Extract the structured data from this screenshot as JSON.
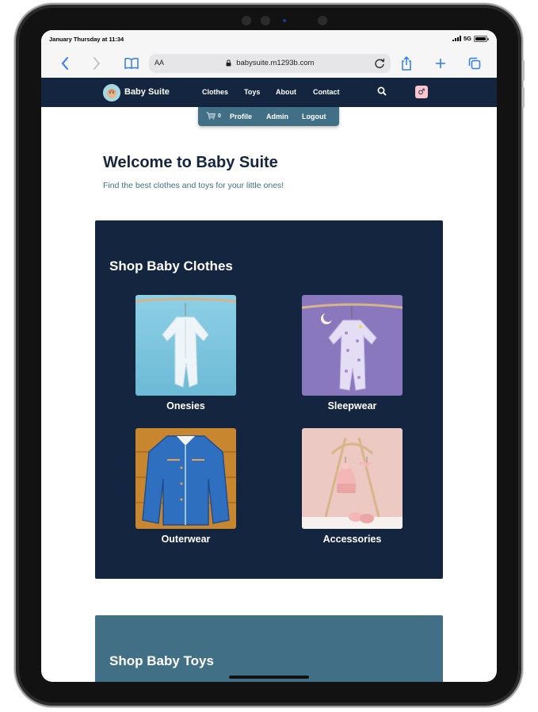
{
  "status_bar": {
    "time": "January Thursday at 11:34",
    "network": "5G"
  },
  "browser": {
    "text_size_label": "AA",
    "url": "babysuite.m1293b.com",
    "icons": [
      "back-icon",
      "forward-icon",
      "bookmarks-icon",
      "lock-icon",
      "reload-icon",
      "share-icon",
      "new-tab-icon",
      "tabs-icon"
    ]
  },
  "nav": {
    "brand": "Baby Suite",
    "links": [
      "Clothes",
      "Toys",
      "About",
      "Contact"
    ],
    "search_icon": "search-icon",
    "gender_symbol": "♂"
  },
  "user_menu": {
    "cart_count": "0",
    "profile": "Profile",
    "admin": "Admin",
    "logout": "Logout"
  },
  "hero": {
    "title": "Welcome to Baby Suite",
    "subtitle": "Find the best clothes and toys for your little ones!"
  },
  "clothes_section": {
    "title": "Shop Baby Clothes",
    "categories": [
      {
        "label": "Onesies"
      },
      {
        "label": "Sleepwear"
      },
      {
        "label": "Outerwear"
      },
      {
        "label": "Accessories"
      }
    ]
  },
  "toys_section": {
    "title": "Shop Baby Toys"
  },
  "colors": {
    "navy": "#14253f",
    "teal": "#417086",
    "accent_blue": "#2f7cf6",
    "pink": "#f7c6cf"
  }
}
